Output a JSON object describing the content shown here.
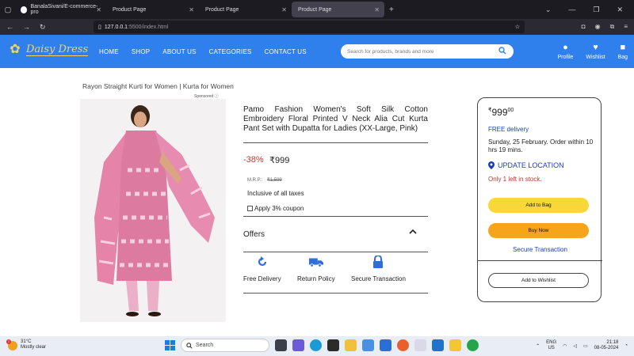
{
  "browser": {
    "tabs": [
      {
        "label": "BanalaSivani/E-commerce-pro"
      },
      {
        "label": "Product Page"
      },
      {
        "label": "Product Page"
      },
      {
        "label": "Product Page"
      }
    ],
    "url_host": "127.0.0.1",
    "url_path": ":5500/index.html"
  },
  "site": {
    "logo_text": "Daisy Dress",
    "menu": [
      "HOME",
      "SHOP",
      "ABOUT US",
      "CATEGORIES",
      "CONTACT US"
    ],
    "search_placeholder": "Search for products, brands and more",
    "header_icons": [
      {
        "label": "Profile",
        "icon": "person-icon"
      },
      {
        "label": "Wishlist",
        "icon": "heart-icon"
      },
      {
        "label": "Bag",
        "icon": "bag-icon"
      }
    ]
  },
  "product": {
    "breadcrumb": "Rayon Straight Kurti for Women | Kurta for Women",
    "sponsored": "Sponsored ⓘ",
    "title": "Pamo Fashion Women's Soft Silk Cotton Embroidery Floral Printed V Neck Alia Cut Kurta Pant Set with Dupatta for Ladies (XX-Large, Pink)",
    "discount": "-38%",
    "price": "₹999",
    "mrp_label": "M.R.P.:",
    "mrp_value": "₹1,599",
    "taxes": "Inclusive of all taxes",
    "coupon": "Apply 3% coupon",
    "offers_label": "Offers",
    "features": [
      {
        "label": "Free Delivery",
        "icon": "refresh-icon"
      },
      {
        "label": "Return Policy",
        "icon": "truck-icon"
      },
      {
        "label": "Secure Transaction",
        "icon": "lock-icon"
      }
    ]
  },
  "buybox": {
    "price_symbol": "₹",
    "price_main": "999",
    "price_fraction": "00",
    "free_delivery": "FREE delivery",
    "delivery_text": "Sunday, 25 February. Order within 10 hrs 19 mins.",
    "update_location": "UPDATE LOCATION",
    "stock": "Only 1 left in stock.",
    "add_to_bag": "Add to Bag",
    "buy_now": "Buy Now",
    "secure": "Secure Transaction",
    "add_to_wishlist": "Add to Wishlist"
  },
  "taskbar": {
    "temp": "31°C",
    "weather": "Mostly clear",
    "weather_badge": "1",
    "search": "Search",
    "lang_1": "ENG",
    "lang_2": "US",
    "time": "21:18",
    "date": "08-05-2024"
  },
  "colors": {
    "header_blue": "#2f80ed",
    "link_blue": "#1a3fb5",
    "discount_red": "#c0392b",
    "bag_yellow": "#f7d838",
    "buy_orange": "#f7a41d",
    "dress_pink": "#e583a8"
  }
}
